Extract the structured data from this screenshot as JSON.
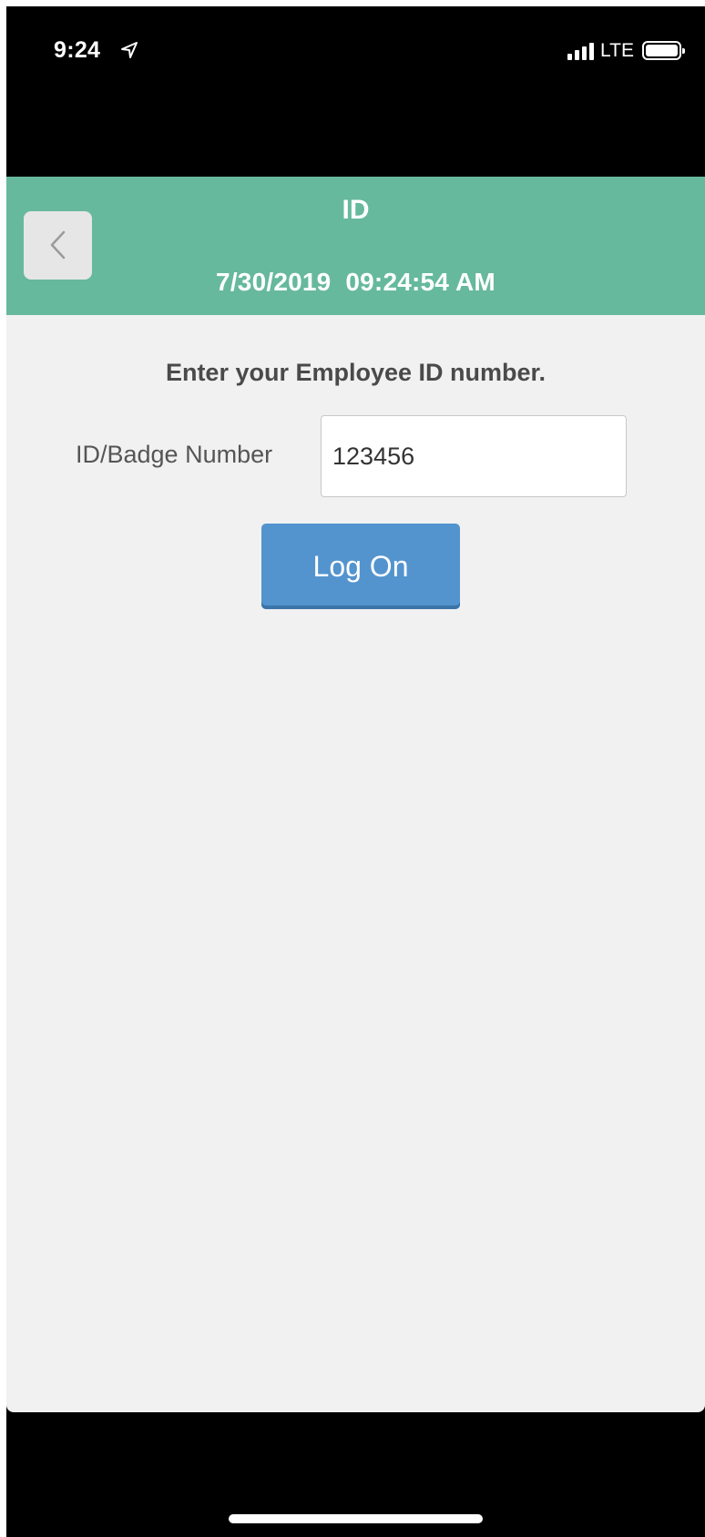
{
  "status_bar": {
    "time": "9:24",
    "network": "LTE",
    "location_icon": "location-arrow-icon",
    "signal_icon": "cellular-signal-icon",
    "battery_icon": "battery-icon"
  },
  "header": {
    "title": "ID",
    "datetime": "7/30/2019  09:24:54 AM",
    "back_icon": "chevron-left-icon",
    "color": "#66b99c"
  },
  "form": {
    "prompt": "Enter your Employee ID number.",
    "id_label": "ID/Badge Number",
    "id_value": "123456",
    "logon_label": "Log On"
  },
  "colors": {
    "accent_button": "#5394ce",
    "page_background": "#f1f1f1"
  }
}
